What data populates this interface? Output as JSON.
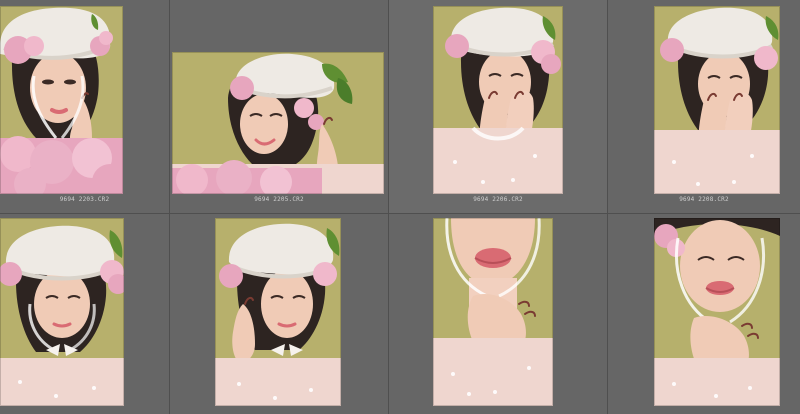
{
  "thumbnails": [
    {
      "filename": "9694 2203.CR2"
    },
    {
      "filename": "9694 2205.CR2"
    },
    {
      "filename": "9694 2206.CR2"
    },
    {
      "filename": "9694 2208.CR2"
    },
    {
      "filename": ""
    },
    {
      "filename": ""
    },
    {
      "filename": ""
    },
    {
      "filename": ""
    }
  ],
  "colors": {
    "backdrop": "#b3ad6a",
    "skin": "#f0cbb6",
    "hat": "#eeeae4",
    "flowers": "#e7a6be",
    "dress": "#efd6cf",
    "hair": "#2d2421",
    "leaf": "#5f8f32",
    "nails": "#7a3b32",
    "lips": "#d96b73"
  }
}
